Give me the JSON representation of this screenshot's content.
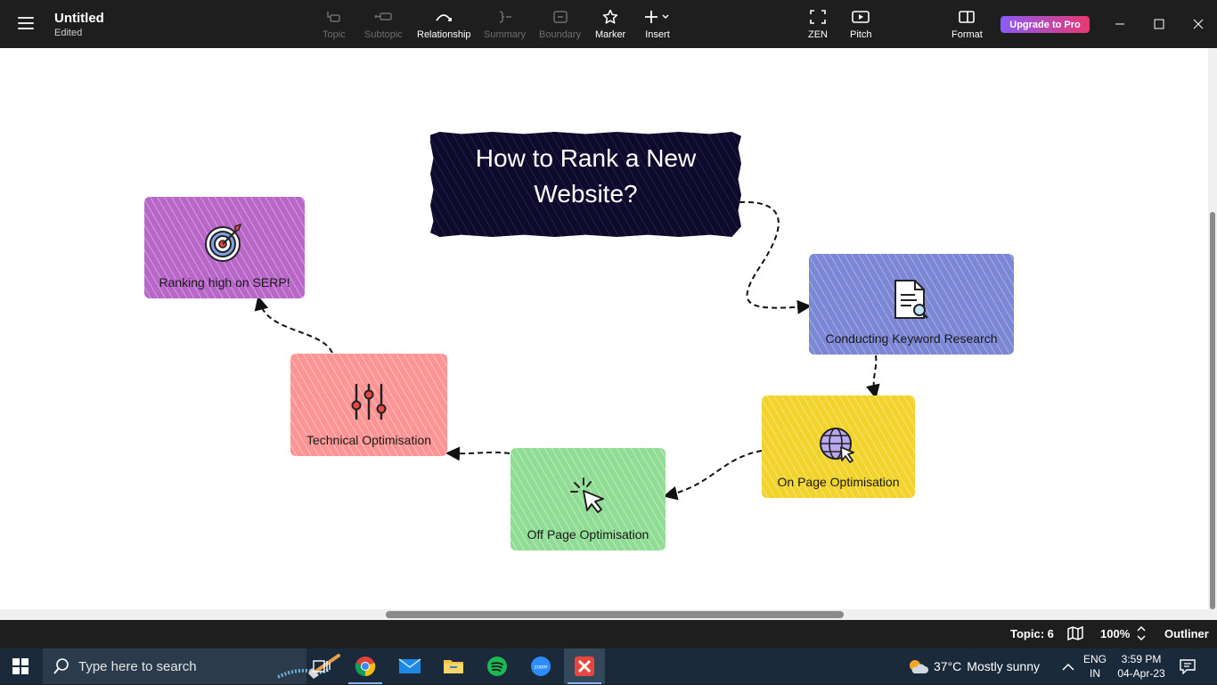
{
  "app": {
    "title": "Untitled",
    "status": "Edited"
  },
  "toolbar": {
    "items": [
      {
        "label": "Topic",
        "enabled": false
      },
      {
        "label": "Subtopic",
        "enabled": false
      },
      {
        "label": "Relationship",
        "enabled": true
      },
      {
        "label": "Summary",
        "enabled": false
      },
      {
        "label": "Boundary",
        "enabled": false
      },
      {
        "label": "Marker",
        "enabled": true
      },
      {
        "label": "Insert",
        "enabled": true
      }
    ],
    "zen_label": "ZEN",
    "pitch_label": "Pitch",
    "format_label": "Format",
    "upgrade_label": "Upgrade to Pro"
  },
  "mindmap": {
    "central": {
      "line1": "How to Rank a New",
      "line2": "Website?",
      "color": "#0d0a2b"
    },
    "topics": [
      {
        "label": "Conducting Keyword Research",
        "icon": "document-search-icon",
        "color": "#7b86d4"
      },
      {
        "label": "On Page Optimisation",
        "icon": "globe-cursor-icon",
        "color": "#f2d32b"
      },
      {
        "label": "Off Page Optimisation",
        "icon": "cursor-click-icon",
        "color": "#8fdc94"
      },
      {
        "label": "Technical Optimisation",
        "icon": "sliders-icon",
        "color": "#ff9494"
      },
      {
        "label": "Ranking high on SERP!",
        "icon": "target-icon",
        "color": "#b867c9"
      }
    ]
  },
  "statusbar": {
    "topic_count": "Topic: 6",
    "zoom": "100%",
    "outliner": "Outliner"
  },
  "taskbar": {
    "search_placeholder": "Type here to search",
    "weather_temp": "37°C",
    "weather_text": "Mostly sunny",
    "lang_line1": "ENG",
    "lang_line2": "IN",
    "time": "3:59 PM",
    "date": "04-Apr-23"
  }
}
